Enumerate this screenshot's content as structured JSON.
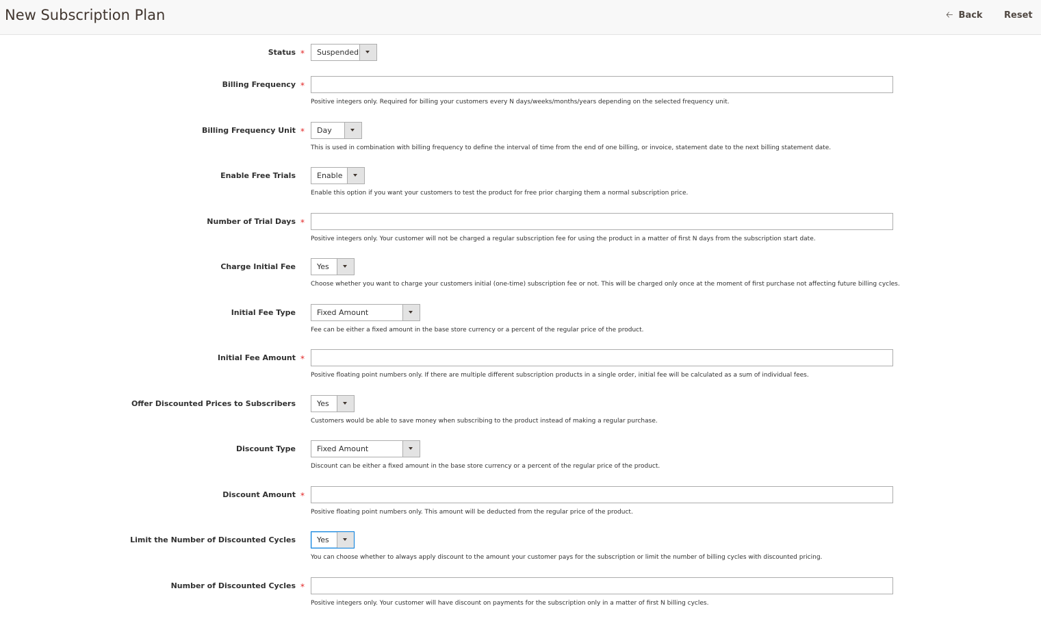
{
  "header": {
    "title": "New Subscription Plan",
    "back_label": "Back",
    "back_icon": "arrow-left-icon",
    "reset_label": "Reset"
  },
  "required_mark": "*",
  "fields": {
    "status": {
      "label": "Status",
      "value": "Suspended"
    },
    "billing_frequency": {
      "label": "Billing Frequency",
      "value": "",
      "note": "Positive integers only. Required for billing your customers every N days/weeks/months/years depending on the selected frequency unit."
    },
    "billing_frequency_unit": {
      "label": "Billing Frequency Unit",
      "value": "Day",
      "note": "This is used in combination with billing frequency to define the interval of time from the end of one billing, or invoice, statement date to the next billing statement date."
    },
    "enable_free_trials": {
      "label": "Enable Free Trials",
      "value": "Enable",
      "note": "Enable this option if you want your customers to test the product for free prior charging them a normal subscription price."
    },
    "trial_days": {
      "label": "Number of Trial Days",
      "value": "",
      "note": "Positive integers only. Your customer will not be charged a regular subscription fee for using the product in a matter of first N days from the subscription start date."
    },
    "charge_initial_fee": {
      "label": "Charge Initial Fee",
      "value": "Yes",
      "note": "Choose whether you want to charge your customers initial (one-time) subscription fee or not. This will be charged only once at the moment of first purchase not affecting future billing cycles."
    },
    "initial_fee_type": {
      "label": "Initial Fee Type",
      "value": "Fixed Amount",
      "note": "Fee can be either a fixed amount in the base store currency or a percent of the regular price of the product."
    },
    "initial_fee_amount": {
      "label": "Initial Fee Amount",
      "value": "",
      "note": "Positive floating point numbers only. If there are multiple different subscription products in a single order, initial fee will be calculated as a sum of individual fees."
    },
    "offer_discounted": {
      "label": "Offer Discounted Prices to Subscribers",
      "value": "Yes",
      "note": "Customers would be able to save money when subscribing to the product instead of making a regular purchase."
    },
    "discount_type": {
      "label": "Discount Type",
      "value": "Fixed Amount",
      "note": "Discount can be either a fixed amount in the base store currency or a percent of the regular price of the product."
    },
    "discount_amount": {
      "label": "Discount Amount",
      "value": "",
      "note": "Positive floating point numbers only. This amount will be deducted from the regular price of the product."
    },
    "limit_discounted_cycles": {
      "label": "Limit the Number of Discounted Cycles",
      "value": "Yes",
      "note": "You can choose whether to always apply discount to the amount your customer pays for the subscription or limit the number of billing cycles with discounted pricing."
    },
    "discounted_cycles": {
      "label": "Number of Discounted Cycles",
      "value": "",
      "note": "Positive integers only. Your customer will have discount on payments for the subscription only in a matter of first N billing cycles."
    }
  }
}
